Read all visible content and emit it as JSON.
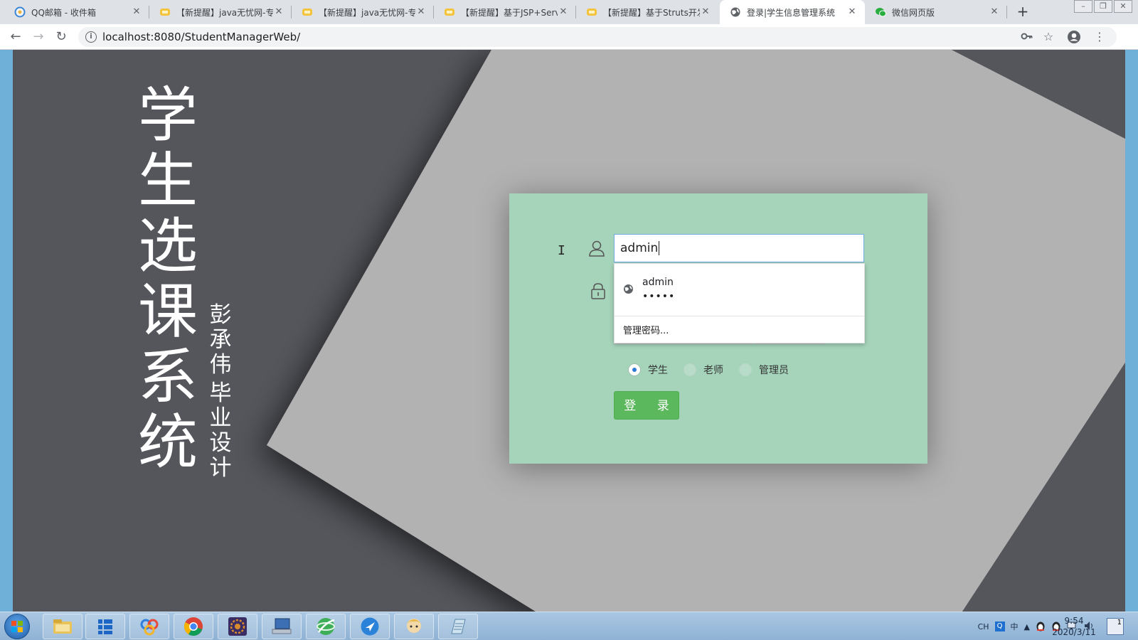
{
  "browser": {
    "tabs": [
      {
        "title": "QQ邮箱 - 收件箱",
        "active": false
      },
      {
        "title": "【新提醒】java无忧网-专",
        "active": false
      },
      {
        "title": "【新提醒】java无忧网-专",
        "active": false
      },
      {
        "title": "【新提醒】基于JSP+Serv",
        "active": false
      },
      {
        "title": "【新提醒】基于Struts开发",
        "active": false
      },
      {
        "title": "登录|学生信息管理系统",
        "active": true
      },
      {
        "title": "微信网页版",
        "active": false
      }
    ],
    "new_tab_symbol": "+",
    "address": "localhost:8080/StudentManagerWeb/",
    "icons": [
      "back-icon",
      "forward-icon",
      "reload-icon",
      "info-icon",
      "key-icon",
      "star-icon",
      "account-icon",
      "menu-icon"
    ]
  },
  "page": {
    "title_chars": [
      "学",
      "生",
      "选",
      "课",
      "系",
      "统"
    ],
    "author_chars": [
      "彭",
      "承",
      "伟"
    ],
    "subtitle_chars": [
      "毕",
      "业",
      "设",
      "计"
    ],
    "colors": {
      "background": "#55565c",
      "light_shape": "#b2b2b2",
      "login_panel": "#a6d4ba",
      "login_button": "#5cb85c"
    }
  },
  "login": {
    "username_value": "admin",
    "autofill": {
      "username": "admin",
      "password_mask": "•••••",
      "manage_label": "管理密码..."
    },
    "roles": [
      {
        "label": "学生",
        "checked": true
      },
      {
        "label": "老师",
        "checked": false
      },
      {
        "label": "管理员",
        "checked": false
      }
    ],
    "submit_label": "登 录"
  },
  "taskbar": {
    "apps": [
      "file-explorer-icon",
      "tile-app-icon",
      "baidu-netdisk-icon",
      "chrome-icon",
      "javaee-ide-icon",
      "computer-icon",
      "network-icon",
      "feather-app-icon",
      "avatar-app-icon",
      "notepad-icon"
    ],
    "tray_text": [
      "CH",
      "中"
    ],
    "time": "9:54",
    "date": "2020/3/11"
  }
}
